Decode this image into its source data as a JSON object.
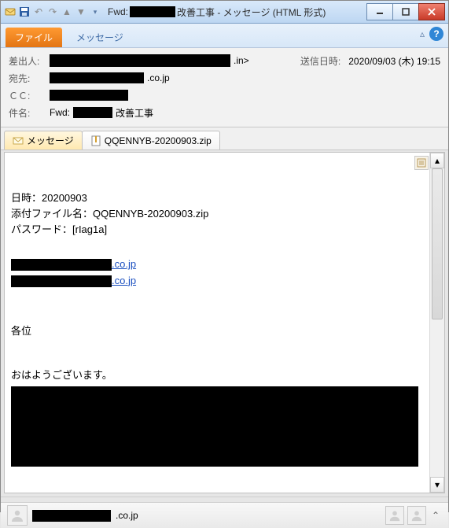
{
  "window": {
    "title_prefix": "Fwd:",
    "title_suffix": "改善工事 - メッセージ (HTML 形式)"
  },
  "ribbon": {
    "file_label": "ファイル",
    "message_label": "メッセージ"
  },
  "header": {
    "from_label": "差出人:",
    "from_suffix": ".in>",
    "sent_label": "送信日時:",
    "sent_value": "2020/09/03 (木) 19:15",
    "to_label": "宛先:",
    "to_suffix": ".co.jp",
    "cc_label": "ＣＣ:",
    "subject_label": "件名:",
    "subject_prefix": "Fwd:",
    "subject_suffix": "改善工事"
  },
  "tabs": {
    "message_tab": "メッセージ",
    "attachment_name": "QQENNYB-20200903.zip"
  },
  "body": {
    "line1": "日時：20200903",
    "line2": "添付ファイル名：QQENNYB-20200903.zip",
    "line3": "パスワード：[rIag1a]",
    "link_suffix1": ".co.jp",
    "link_suffix2": ".co.jp",
    "line4": "各位",
    "line5": "おはようございます。"
  },
  "people": {
    "name_suffix": ".co.jp"
  }
}
